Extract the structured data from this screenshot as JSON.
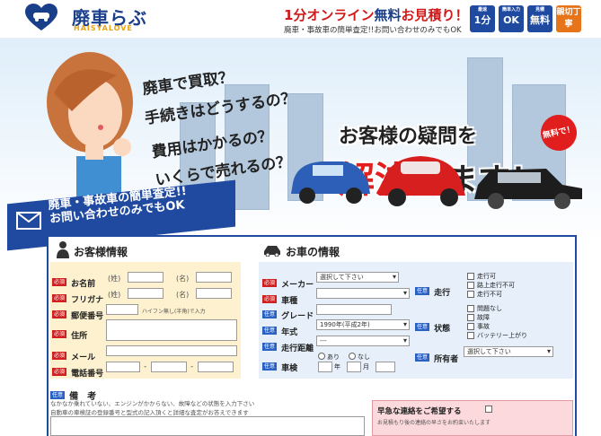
{
  "header": {
    "logo_text": "廃車らぶ",
    "logo_sub": "HAISYALOVE",
    "logo_badge": "HAISYALOVE",
    "tagline_prefix": "1分オンライン",
    "tagline_free": "無料",
    "tagline_suffix": "お見積り！",
    "tagline_sub": "廃車・事故車の簡単査定!!お問い合わせのみでもOK",
    "badges": [
      {
        "top": "最速",
        "main": "1分",
        "color": "#1f4aa0"
      },
      {
        "top": "簡単入力",
        "main": "OK",
        "color": "#1f4aa0"
      },
      {
        "top": "見積",
        "main": "無料",
        "color": "#1f4aa0"
      },
      {
        "top": "",
        "main": "親切丁寧",
        "color": "#e8741a"
      }
    ]
  },
  "hero": {
    "questions": [
      "廃車で買取？",
      "手続きはどうするの？",
      "費用はかかるの？",
      "いくらで売れるの？"
    ],
    "headline": "お客様の疑問を",
    "headline_red": "解決",
    "headline_black": "します！",
    "free_badge": "無料で！",
    "banner_line1": "廃車・事故車の簡単査定!!",
    "banner_line2": "お問い合わせのみでもOK",
    "colors": {
      "banner": "#1f4aa0",
      "red": "#e41d1d"
    }
  },
  "form": {
    "customer": {
      "title": "お客様情報",
      "req": "必須",
      "opt": "任意",
      "name_label": "お名前",
      "furigana_label": "フリガナ",
      "sei": "(姓)",
      "mei": "(名)",
      "sei_kana": "(姓)",
      "mei_kana": "(名)",
      "zip_label": "郵便番号",
      "zip_hint": "ハイフン無し(半角)で入力",
      "address_label": "住所",
      "mail_label": "メール",
      "phone_label": "電話番号",
      "dash": "-"
    },
    "car": {
      "title": "お車の情報",
      "maker_label": "メーカー",
      "maker_value": "選択して下さい",
      "model_label": "車種",
      "grade_label": "グレード",
      "year_label": "年式",
      "year_value": "1990年(平成2年)",
      "mileage_label": "走行距離",
      "mileage_value": "---",
      "inspection_label": "車検",
      "inspection_yes": "あり",
      "inspection_no": "なし",
      "year_unit": "年",
      "month_unit": "月",
      "run_label": "走行",
      "run_options": [
        "走行可",
        "路上走行不可",
        "走行不可"
      ],
      "state_label": "状態",
      "state_options": [
        "問題なし",
        "故障",
        "事故",
        "バッテリー上がり"
      ],
      "owner_label": "所有者",
      "owner_value": "選択して下さい"
    },
    "remarks": {
      "label": "備　考",
      "line1": "なかなか乗れていない、エンジンがかからない、故障などの状態を入力下さい",
      "line2": "自動車の車検証の登録番号と型式の記入頂くと詳細な査定がお答えできます"
    },
    "rush": {
      "title": "早急な連絡をご希望する",
      "sub": "お見積もり後の連絡の早さをお約束いたします"
    }
  }
}
